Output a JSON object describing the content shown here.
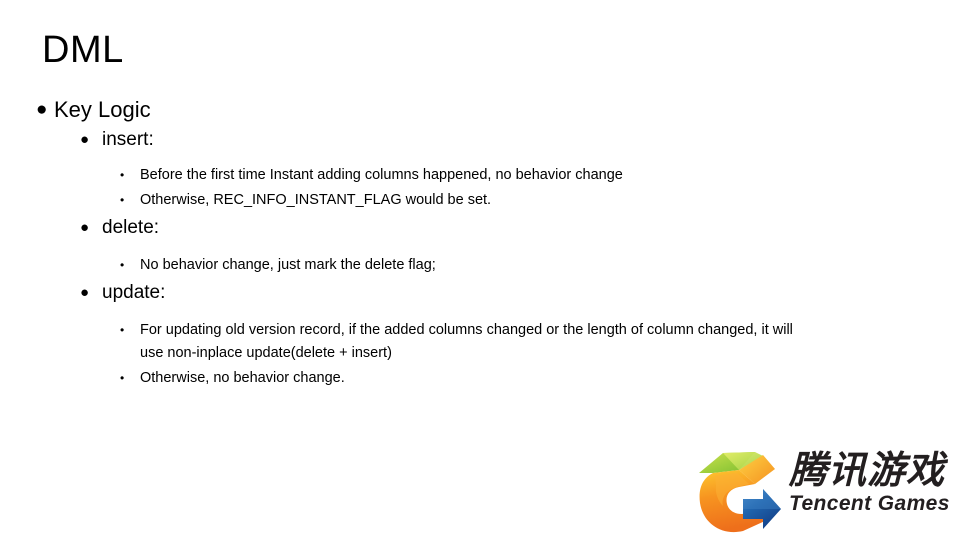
{
  "slide": {
    "title": "DML",
    "background_color": "#ffffff",
    "text_color": "#000000"
  },
  "content": {
    "level1": {
      "bullet_glyph": "●",
      "label": "Key Logic"
    },
    "sections": [
      {
        "bullet_glyph": "●",
        "label": "insert:",
        "items": [
          {
            "bullet_glyph": "•",
            "text": "Before the first time Instant adding columns  happened, no behavior change"
          },
          {
            "bullet_glyph": "•",
            "text": "Otherwise, REC_INFO_INSTANT_FLAG  would be set."
          }
        ]
      },
      {
        "bullet_glyph": "●",
        "label": "delete:",
        "items": [
          {
            "bullet_glyph": "•",
            "text": "No behavior change, just mark the delete flag;"
          }
        ]
      },
      {
        "bullet_glyph": "●",
        "label": "update:",
        "items": [
          {
            "bullet_glyph": "•",
            "text": "For updating old version record, if the added columns changed or the length of column changed, it will use non-inplace update(delete + insert)"
          },
          {
            "bullet_glyph": "•",
            "text": "Otherwise,  no behavior change."
          }
        ]
      }
    ]
  },
  "logo": {
    "name": "tencent-games-logo",
    "chinese_text": "腾讯游戏",
    "english_text": "Tencent Games",
    "colors": {
      "leaf_green_light": "#b5d94c",
      "leaf_green": "#8cc63f",
      "orange_light": "#fbbb21",
      "orange": "#f58220",
      "orange_deep": "#ef7d1a",
      "blue": "#1b5fad",
      "blue_light": "#3a80c8",
      "text": "#231f20"
    }
  }
}
